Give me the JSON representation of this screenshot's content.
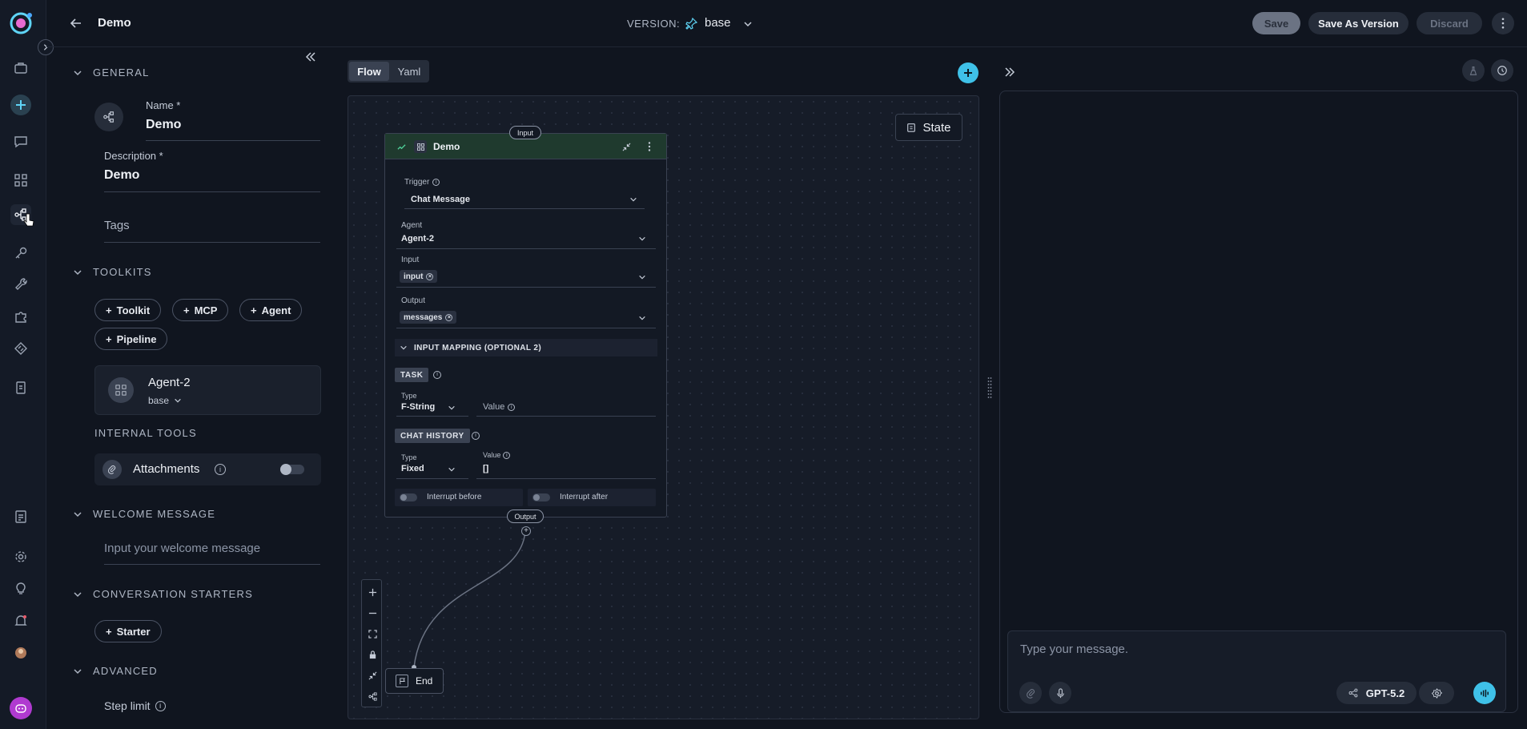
{
  "header": {
    "title": "Demo",
    "version_label": "VERSION:",
    "version_value": "base",
    "save_label": "Save",
    "save_as_version_label": "Save As Version",
    "discard_label": "Discard"
  },
  "general": {
    "section_label": "GENERAL",
    "name_label": "Name *",
    "name_value": "Demo",
    "description_label": "Description *",
    "description_value": "Demo",
    "tags_placeholder": "Tags"
  },
  "toolkits": {
    "section_label": "TOOLKITS",
    "add_buttons": [
      "Toolkit",
      "MCP",
      "Agent",
      "Pipeline"
    ],
    "agent_card": {
      "name": "Agent-2",
      "version": "base"
    }
  },
  "internal_tools": {
    "section_label": "INTERNAL TOOLS",
    "attachments_label": "Attachments",
    "attachments_enabled": false
  },
  "welcome": {
    "section_label": "WELCOME MESSAGE",
    "placeholder": "Input your welcome message"
  },
  "starters": {
    "section_label": "CONVERSATION STARTERS",
    "add_label": "Starter"
  },
  "advanced": {
    "section_label": "ADVANCED",
    "step_limit_label": "Step limit"
  },
  "canvas": {
    "tabs": [
      "Flow",
      "Yaml"
    ],
    "active_tab": "Flow",
    "state_button": "State",
    "node": {
      "input_port": "Input",
      "output_port": "Output",
      "title": "Demo",
      "trigger_label": "Trigger",
      "trigger_value": "Chat Message",
      "agent_label": "Agent",
      "agent_value": "Agent-2",
      "input_label": "Input",
      "input_chip": "input",
      "output_label": "Output",
      "output_chip": "messages",
      "mapping_label": "INPUT MAPPING (OPTIONAL 2)",
      "task_badge": "TASK",
      "task_type_label": "Type",
      "task_type_value": "F-String",
      "task_value_label": "Value",
      "history_badge": "CHAT HISTORY",
      "history_type_label": "Type",
      "history_type_value": "Fixed",
      "history_value_label": "Value",
      "history_value": "[]",
      "interrupt_before": "Interrupt before",
      "interrupt_after": "Interrupt after"
    },
    "end_node": "End"
  },
  "chat": {
    "placeholder": "Type your message.",
    "model": "GPT-5.2"
  },
  "colors": {
    "accent": "#3fc1e8",
    "background": "#10151f",
    "node_header": "#1f3a2e"
  }
}
